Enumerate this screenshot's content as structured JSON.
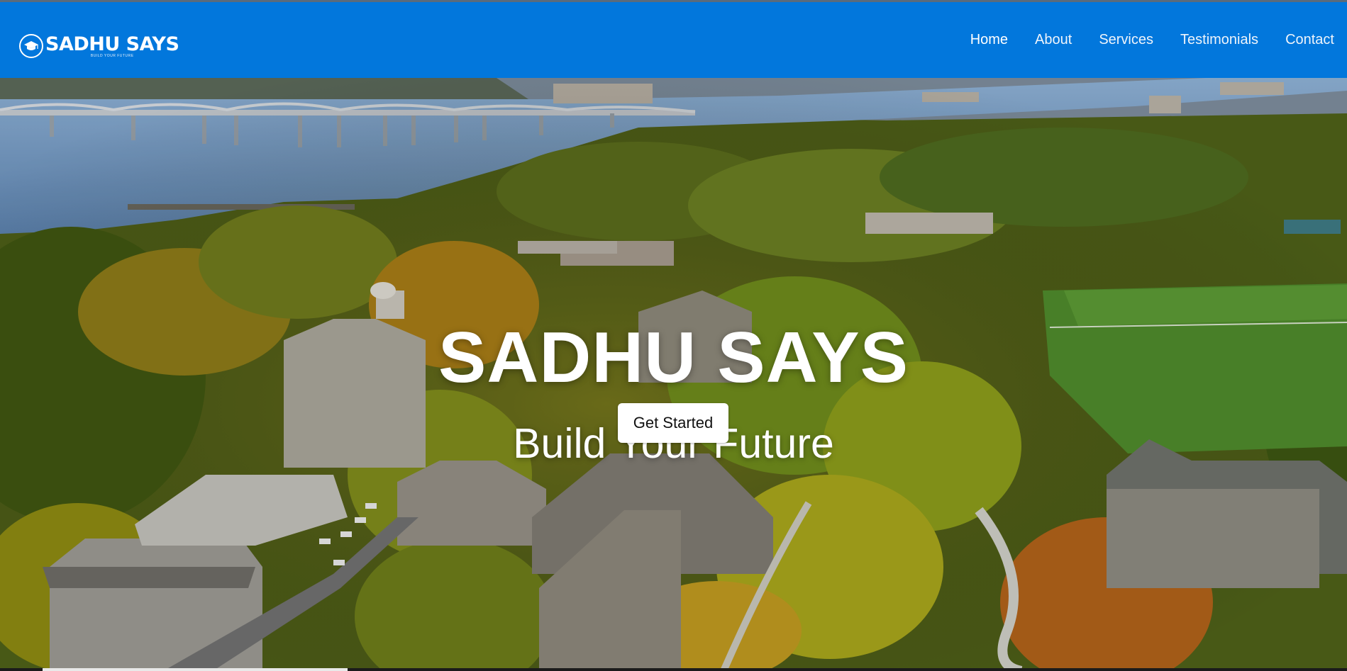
{
  "brand": {
    "name": "SADHU SAYS",
    "tagline": "BUILD YOUR FUTURE",
    "logo_icon": "graduation-cap-icon",
    "primary_color": "#0277dc"
  },
  "nav": {
    "items": [
      {
        "label": "Home",
        "active": true
      },
      {
        "label": "About",
        "active": false
      },
      {
        "label": "Services",
        "active": false
      },
      {
        "label": "Testimonials",
        "active": false
      },
      {
        "label": "Contact",
        "active": false
      }
    ]
  },
  "hero": {
    "title": "SADHU SAYS",
    "subtitle": "Build Your Future",
    "cta_label": "Get Started"
  }
}
